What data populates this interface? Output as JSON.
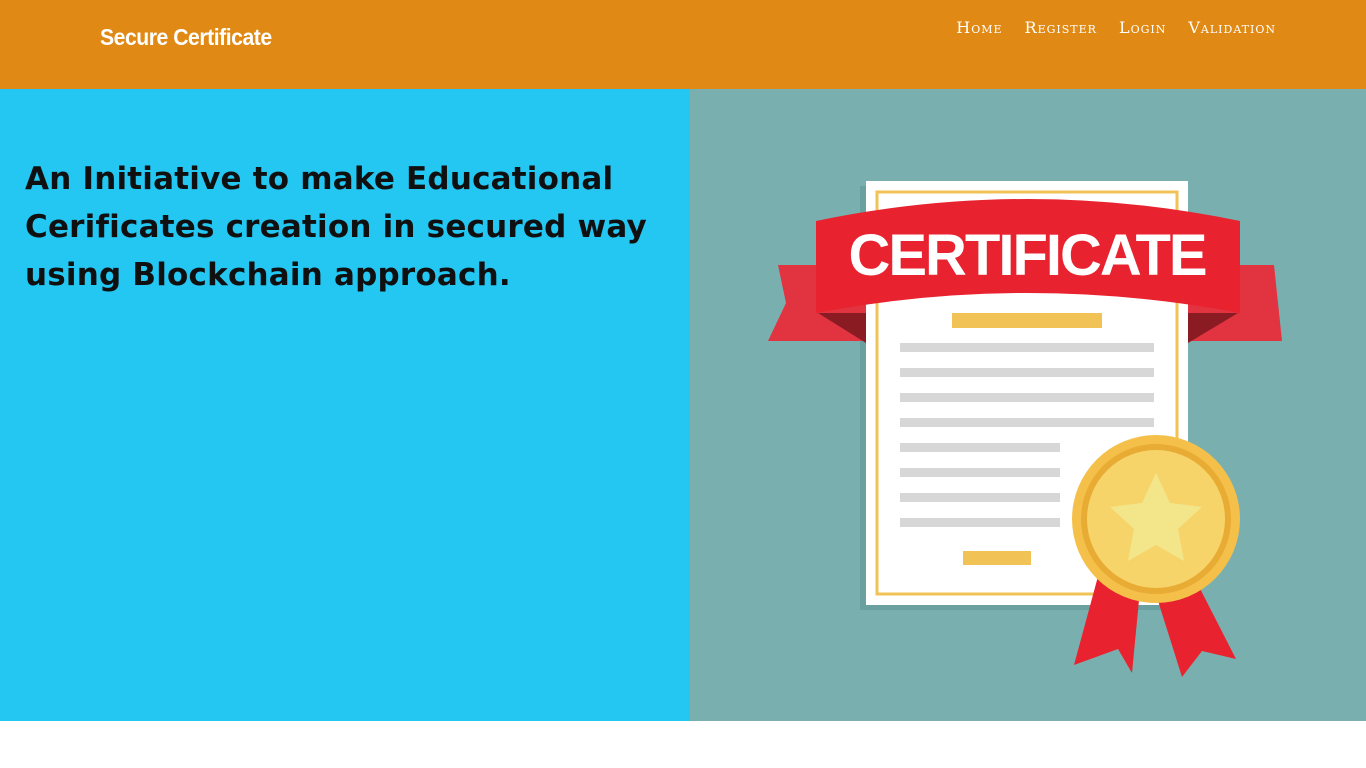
{
  "header": {
    "brand": "Secure Certificate",
    "nav": [
      {
        "label": "Home"
      },
      {
        "label": "Register"
      },
      {
        "label": "Login"
      },
      {
        "label": "Validation"
      }
    ]
  },
  "hero": {
    "text": "An Initiative to make Educational Cerificates creation in secured way using Blockchain approach.",
    "illustration": {
      "ribbon_text": "CERTIFICATE",
      "colors": {
        "left_background": "#24c6f2",
        "right_background": "#79b0af",
        "header_background": "#e08915",
        "ribbon": "#e8232f",
        "medal": "#f4c04a",
        "paper_border": "#f1c255"
      }
    }
  }
}
